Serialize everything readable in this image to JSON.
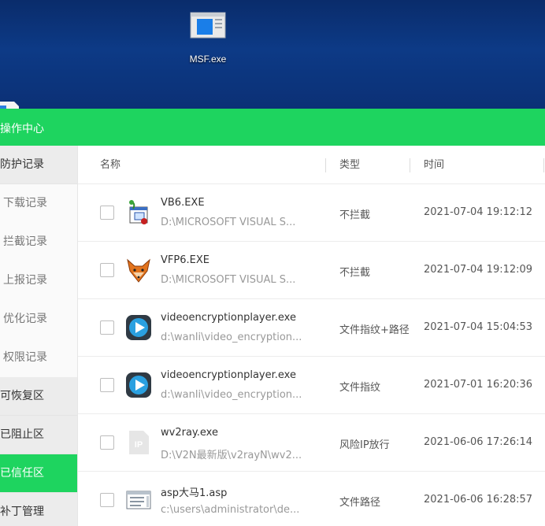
{
  "desktop": {
    "icon_label": "MSF.exe"
  },
  "window": {
    "title": "操作中心"
  },
  "sidebar": {
    "items": [
      {
        "label": "防护记录",
        "kind": "group"
      },
      {
        "label": "下载记录",
        "kind": "sub"
      },
      {
        "label": "拦截记录",
        "kind": "sub"
      },
      {
        "label": "上报记录",
        "kind": "sub"
      },
      {
        "label": "优化记录",
        "kind": "sub"
      },
      {
        "label": "权限记录",
        "kind": "sub"
      },
      {
        "label": "可恢复区",
        "kind": "group"
      },
      {
        "label": "已阻止区",
        "kind": "group"
      },
      {
        "label": "已信任区",
        "kind": "group",
        "active": true
      },
      {
        "label": "补丁管理",
        "kind": "group"
      }
    ]
  },
  "table": {
    "headers": {
      "name": "名称",
      "type": "类型",
      "time": "时间"
    },
    "rows": [
      {
        "icon": "vb6-icon",
        "name": "VB6.EXE",
        "path": "D:\\MICROSOFT VISUAL S...",
        "type": "不拦截",
        "time": "2021-07-04 19:12:12"
      },
      {
        "icon": "vfp6-fox-icon",
        "name": "VFP6.EXE",
        "path": "D:\\MICROSOFT VISUAL S...",
        "type": "不拦截",
        "time": "2021-07-04 19:12:09"
      },
      {
        "icon": "video-player-icon",
        "name": "videoencryptionplayer.exe",
        "path": "d:\\wanli\\video_encryption...",
        "type": "文件指纹+路径",
        "time": "2021-07-04 15:04:53"
      },
      {
        "icon": "video-player-icon",
        "name": "videoencryptionplayer.exe",
        "path": "d:\\wanli\\video_encryption...",
        "type": "文件指纹",
        "time": "2021-07-01 16:20:36"
      },
      {
        "icon": "ip-icon",
        "name": "wv2ray.exe",
        "path": "D:\\V2N最新版\\v2rayN\\wv2...",
        "type": "风险IP放行",
        "time": "2021-06-06 17:26:14"
      },
      {
        "icon": "document-icon",
        "name": "asp大马1.asp",
        "path": "c:\\users\\administrator\\de...",
        "type": "文件路径",
        "time": "2021-06-06 16:28:57"
      }
    ]
  },
  "colors": {
    "accent": "#1ed45f",
    "desktop": "#0d3a86"
  }
}
